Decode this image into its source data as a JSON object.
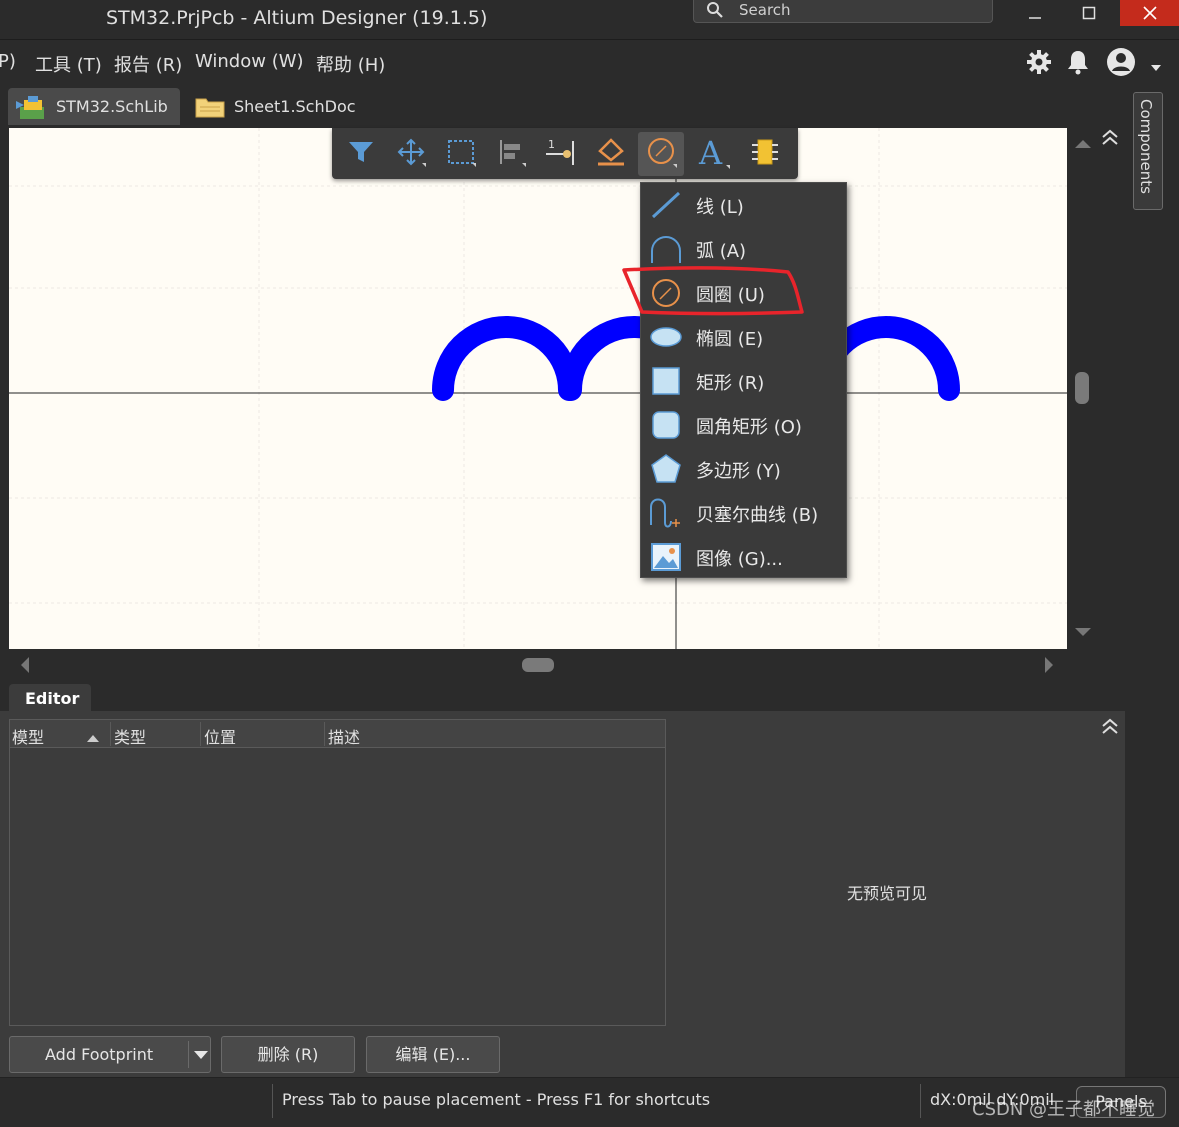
{
  "window": {
    "title": "STM32.PrjPcb - Altium Designer (19.1.5)",
    "search_label": "Search"
  },
  "menu": {
    "items": [
      "P)",
      "工具 (T)",
      "报告 (R)",
      "Window (W)",
      "帮助 (H)"
    ]
  },
  "tabs": [
    {
      "label": "STM32.SchLib *"
    },
    {
      "label": "Sheet1.SchDoc *"
    }
  ],
  "right_panel": {
    "components_label": "Components"
  },
  "toolbar": {
    "tools": [
      "filter-icon",
      "move-icon",
      "select-icon",
      "align-icon",
      "pin-icon",
      "ieee-icon",
      "circle-icon",
      "text-icon",
      "component-icon"
    ],
    "selected_tool": "circle-icon"
  },
  "dropdown": {
    "items": [
      {
        "label": "线 (L)",
        "icon": "line-icon"
      },
      {
        "label": "弧 (A)",
        "icon": "arc-icon"
      },
      {
        "label": "圆圈 (U)",
        "icon": "circle-icon"
      },
      {
        "label": "椭圆 (E)",
        "icon": "ellipse-icon"
      },
      {
        "label": "矩形 (R)",
        "icon": "rectangle-icon"
      },
      {
        "label": "圆角矩形 (O)",
        "icon": "round-rectangle-icon"
      },
      {
        "label": "多边形 (Y)",
        "icon": "polygon-icon"
      },
      {
        "label": "贝塞尔曲线 (B)",
        "icon": "bezier-icon"
      },
      {
        "label": "图像 (G)...",
        "icon": "image-icon"
      }
    ],
    "highlighted": "圆圈 (U)"
  },
  "editor": {
    "tab_label": "Editor",
    "columns": [
      "模型",
      "类型",
      "位置",
      "描述"
    ],
    "no_preview": "无预览可见",
    "add_footprint": "Add Footprint",
    "delete": "删除 (R)",
    "edit": "编辑 (E)..."
  },
  "status": {
    "message": "Press Tab to pause placement - Press F1 for shortcuts",
    "coords": "dX:0mil dY:0mil",
    "panels": "Panels"
  },
  "watermark": "CSDN @王子都不睡觉",
  "colors": {
    "accent_blue": "#0000ff",
    "highlight_red": "#e8242b",
    "toolbar_orange": "#e8914a",
    "icon_blue": "#5b9bd5"
  }
}
